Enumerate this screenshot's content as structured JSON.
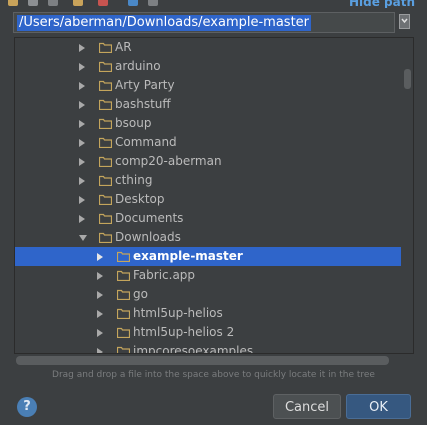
{
  "toolbar": {
    "hide_path_label": "Hide path",
    "icons": [
      "home-icon",
      "desktop-icon",
      "project-icon",
      "new-folder-icon",
      "delete-icon",
      "refresh-icon",
      "show-hidden-icon"
    ]
  },
  "path": {
    "value": "/Users/aberman/Downloads/example-master"
  },
  "tree": {
    "items": [
      {
        "label": "AR",
        "level": 0,
        "expanded": false,
        "selected": false
      },
      {
        "label": "arduino",
        "level": 0,
        "expanded": false,
        "selected": false
      },
      {
        "label": "Arty Party",
        "level": 0,
        "expanded": false,
        "selected": false
      },
      {
        "label": "bashstuff",
        "level": 0,
        "expanded": false,
        "selected": false
      },
      {
        "label": "bsoup",
        "level": 0,
        "expanded": false,
        "selected": false
      },
      {
        "label": "Command",
        "level": 0,
        "expanded": false,
        "selected": false
      },
      {
        "label": "comp20-aberman",
        "level": 0,
        "expanded": false,
        "selected": false
      },
      {
        "label": "cthing",
        "level": 0,
        "expanded": false,
        "selected": false
      },
      {
        "label": "Desktop",
        "level": 0,
        "expanded": false,
        "selected": false
      },
      {
        "label": "Documents",
        "level": 0,
        "expanded": false,
        "selected": false
      },
      {
        "label": "Downloads",
        "level": 0,
        "expanded": true,
        "selected": false
      },
      {
        "label": "example-master",
        "level": 1,
        "expanded": false,
        "selected": true
      },
      {
        "label": "Fabric.app",
        "level": 1,
        "expanded": false,
        "selected": false
      },
      {
        "label": "go",
        "level": 1,
        "expanded": false,
        "selected": false
      },
      {
        "label": "html5up-helios",
        "level": 1,
        "expanded": false,
        "selected": false
      },
      {
        "label": "html5up-helios 2",
        "level": 1,
        "expanded": false,
        "selected": false
      },
      {
        "label": "impcoresoexamples",
        "level": 1,
        "expanded": false,
        "selected": false
      }
    ]
  },
  "hint": "Drag and drop a file into the space above to quickly locate it in the tree",
  "buttons": {
    "help": "?",
    "cancel": "Cancel",
    "ok": "OK"
  },
  "colors": {
    "background": "#3c3f41",
    "selection": "#2f65ca",
    "folder": "#c4a55c",
    "ok_button": "#365880"
  }
}
